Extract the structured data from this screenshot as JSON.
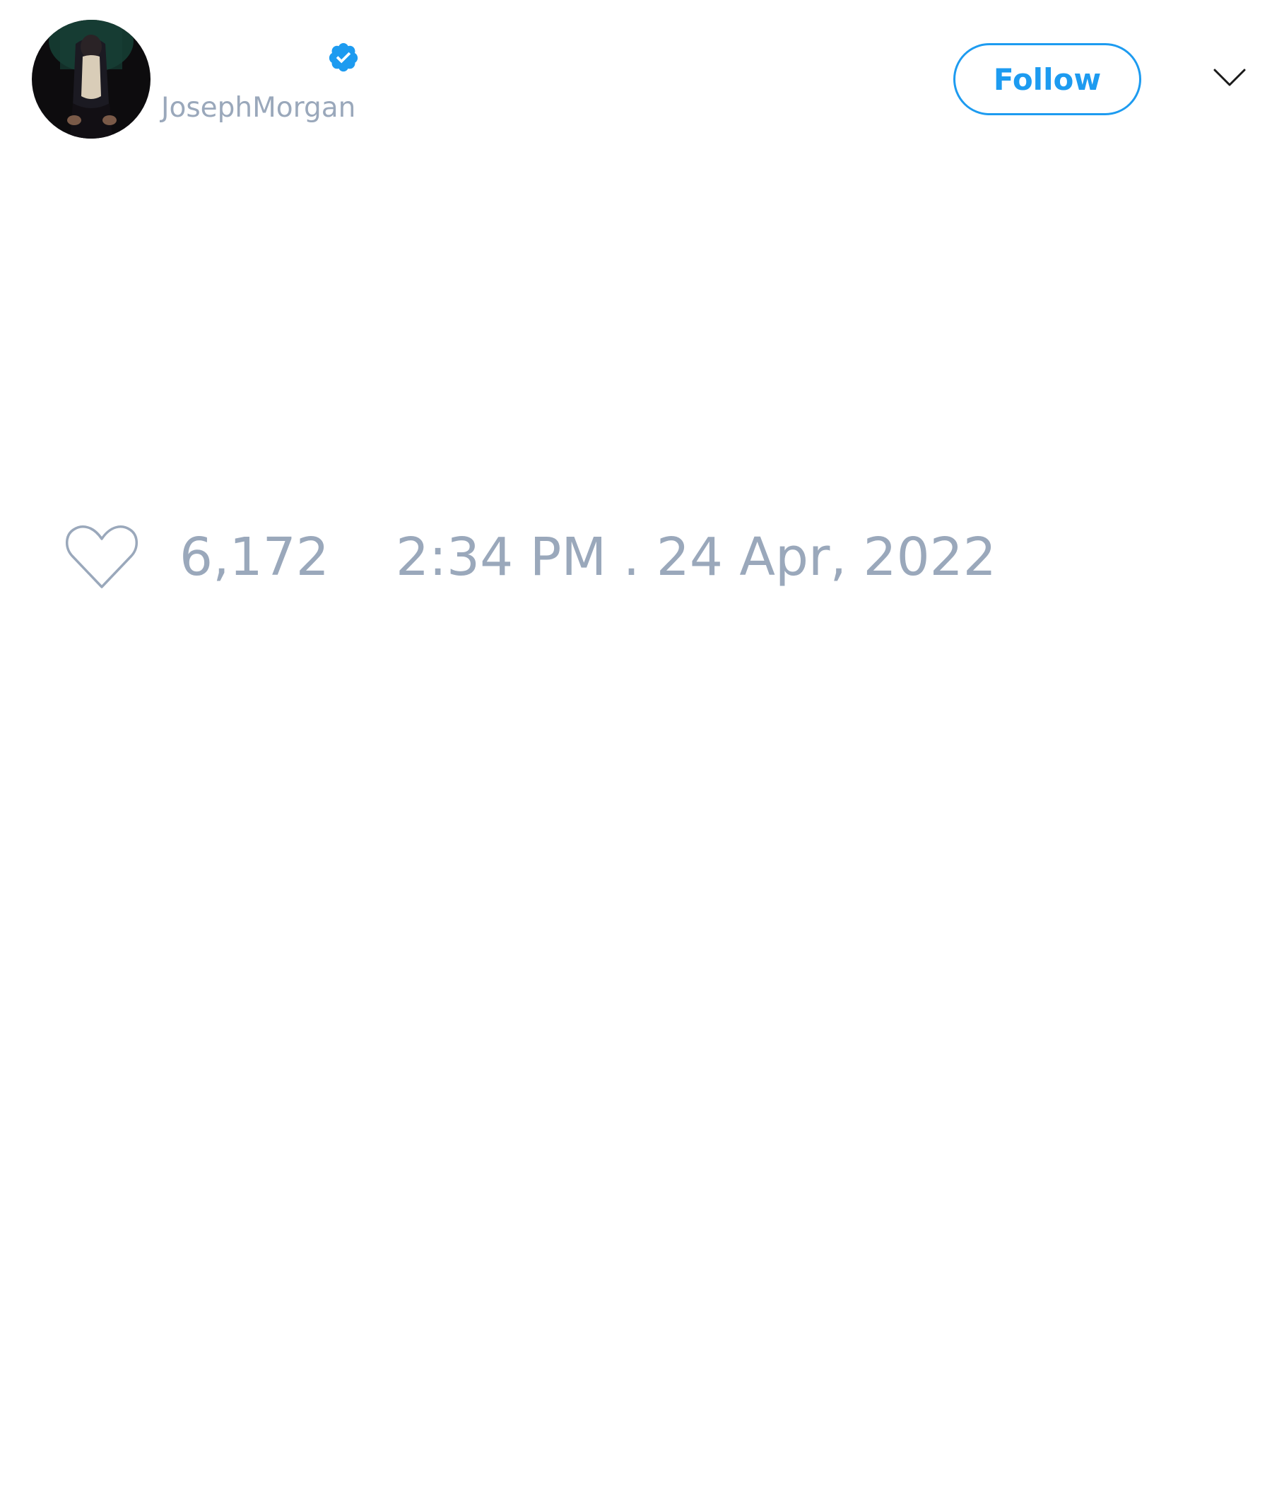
{
  "author": {
    "handle": "JosephMorgan",
    "verified": true,
    "avatar_icon": "profile-photo"
  },
  "header": {
    "follow_label": "Follow",
    "menu_icon": "chevron-down-icon"
  },
  "stats": {
    "like_icon": "heart-outline-icon",
    "like_count": "6,172",
    "timestamp": "2:34 PM . 24 Apr, 2022"
  },
  "colors": {
    "accent": "#1d9bf0",
    "muted_text": "#9aa8bb",
    "background": "#ffffff"
  }
}
